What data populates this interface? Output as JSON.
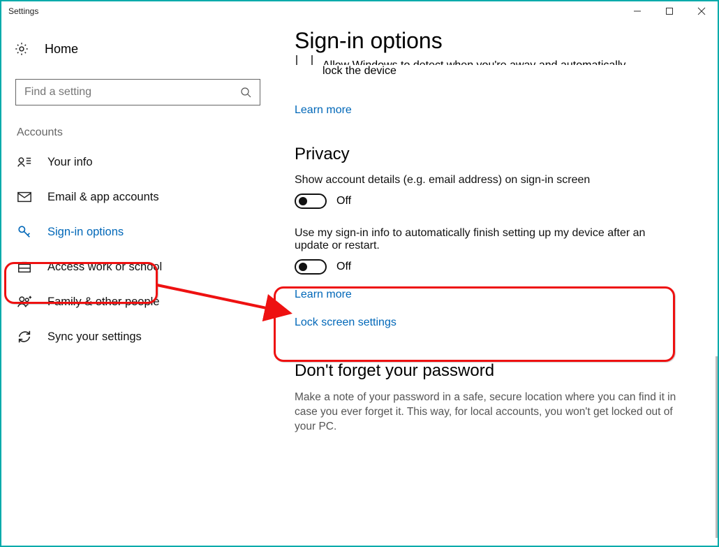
{
  "window": {
    "title": "Settings"
  },
  "sidebar": {
    "home_label": "Home",
    "search_placeholder": "Find a setting",
    "section_label": "Accounts",
    "items": [
      {
        "label": "Your info",
        "icon": "person-card-icon"
      },
      {
        "label": "Email & app accounts",
        "icon": "mail-icon"
      },
      {
        "label": "Sign-in options",
        "icon": "key-icon"
      },
      {
        "label": "Access work or school",
        "icon": "briefcase-icon"
      },
      {
        "label": "Family & other people",
        "icon": "people-icon"
      },
      {
        "label": "Sync your settings",
        "icon": "sync-icon"
      }
    ]
  },
  "main": {
    "page_title": "Sign-in options",
    "lock_device_text_top": "Allow Windows to detect when you're away and automatically",
    "lock_device_text_bottom": "lock the device",
    "learn_more_1": "Learn more",
    "privacy_heading": "Privacy",
    "privacy_setting_1": "Show account details (e.g. email address) on sign-in screen",
    "privacy_toggle_1_state": "Off",
    "privacy_setting_2": "Use my sign-in info to automatically finish setting up my device after an update or restart.",
    "privacy_toggle_2_state": "Off",
    "learn_more_2": "Learn more",
    "lock_screen_link": "Lock screen settings",
    "password_heading": "Don't forget your password",
    "password_body": "Make a note of your password in a safe, secure location where you can find it in case you ever forget it. This way, for local accounts, you won't get locked out of your PC."
  }
}
